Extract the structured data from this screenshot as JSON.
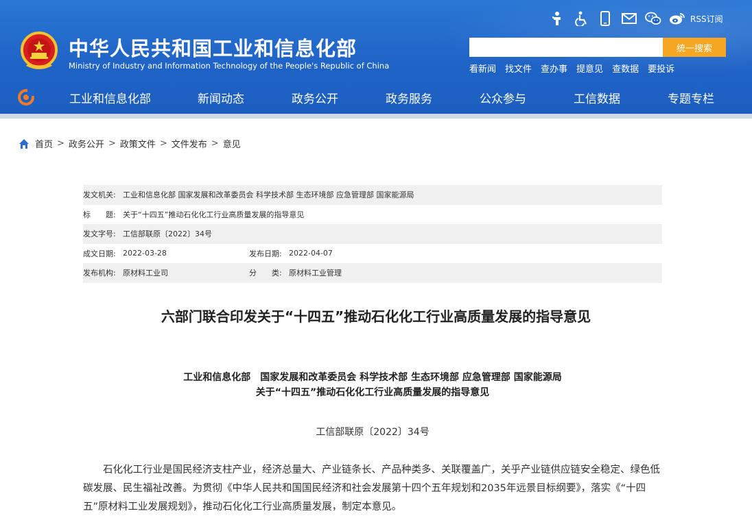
{
  "header": {
    "title": "中华人民共和国工业和信息化部",
    "subtitle": "Ministry of Industry and Information Technology of the People's Republic of China",
    "top_icons": [
      "elderly-mode-icon",
      "accessibility-icon",
      "mobile-icon",
      "mail-icon",
      "wechat-icon",
      "weibo-icon"
    ],
    "rss_label": "RSS订阅",
    "search": {
      "placeholder": "",
      "button_label": "统一搜索"
    },
    "quick_links": [
      "看新闻",
      "找文件",
      "查办事",
      "提意见",
      "查数据",
      "要投诉"
    ],
    "nav": [
      "工业和信息化部",
      "新闻动态",
      "政务公开",
      "政务服务",
      "公众参与",
      "工信数据",
      "专题专栏"
    ],
    "colors": {
      "header_blue": "#1f63c6",
      "search_button": "#f5a623"
    }
  },
  "breadcrumb": {
    "items": [
      "首页",
      "政务公开",
      "政策文件",
      "文件发布",
      "意见"
    ],
    "separator": ">"
  },
  "meta": {
    "issuer_label": "发文机关:",
    "issuer_value": "工业和信息化部 国家发展和改革委员会 科学技术部 生态环境部 应急管理部 国家能源局",
    "title_label": "标　　题:",
    "title_value": "关于“十四五”推动石化化工行业高质量发展的指导意见",
    "docno_label": "发文字号:",
    "docno_value": "工信部联原〔2022〕34号",
    "written_label": "成文日期:",
    "written_value": "2022-03-28",
    "published_label": "发布日期:",
    "published_value": "2022-04-07",
    "agency_label": "发布机构:",
    "agency_value": "原材料工业司",
    "category_label": "分　　类:",
    "category_value": "原材料工业管理"
  },
  "article": {
    "title": "六部门联合印发关于“十四五”推动石化化工行业高质量发展的指导意见",
    "issuers_line": "工业和信息化部　国家发展和改革委员会 科学技术部 生态环境部 应急管理部 国家能源局",
    "doc_title_line": "关于“十四五”推动石化化工行业高质量发展的指导意见",
    "doc_number": "工信部联原〔2022〕34号",
    "paragraph": "石化化工行业是国民经济支柱产业，经济总量大、产业链条长、产品种类多、关联覆盖广，关乎产业链供应链安全稳定、绿色低碳发展、民生福祉改善。为贯彻《中华人民共和国国民经济和社会发展第十四个五年规划和2035年远景目标纲要》，落实《“十四五”原材料工业发展规划》，推动石化化工行业高质量发展，制定本意见。"
  }
}
